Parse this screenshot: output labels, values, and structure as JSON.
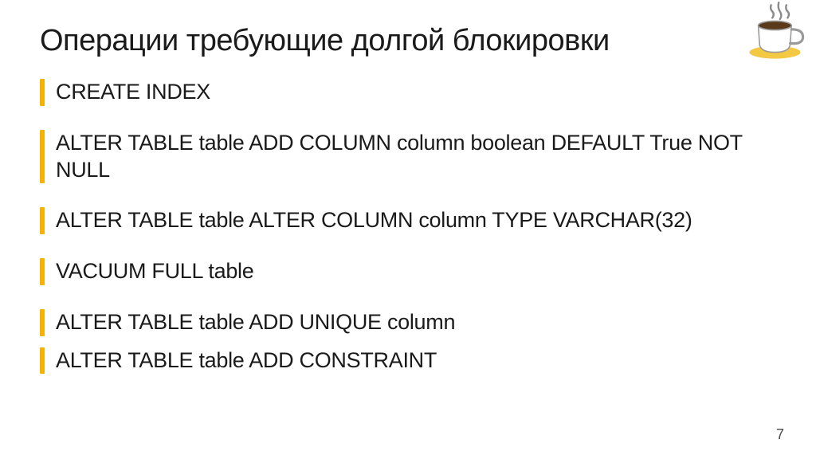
{
  "title": "Операции требующие долгой блокировки",
  "bullets_group1": [
    "CREATE INDEX",
    "ALTER TABLE table ADD COLUMN column boolean DEFAULT True NOT NULL",
    "ALTER TABLE table ALTER COLUMN column TYPE VARCHAR(32)",
    "VACUUM FULL table"
  ],
  "bullets_group2": [
    "ALTER TABLE table ADD UNIQUE column",
    "ALTER TABLE table ADD CONSTRAINT"
  ],
  "page_number": "7"
}
